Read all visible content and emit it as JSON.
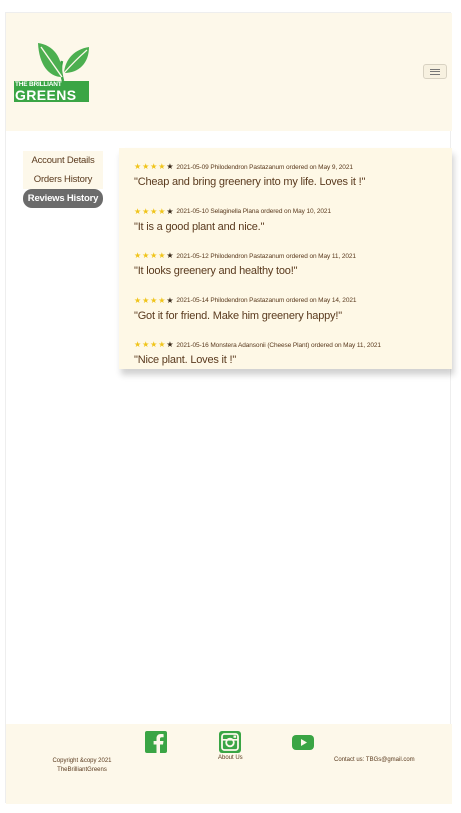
{
  "brand": {
    "line1": "THE BRILLIANT",
    "line2": "GREENS",
    "green": "#3aa545",
    "leaf_green": "#4caf50"
  },
  "header": {
    "menu_icon": "hamburger-menu-icon"
  },
  "sidebar": {
    "items": [
      {
        "label": "Account Details",
        "active": false
      },
      {
        "label": "Orders History",
        "active": false
      },
      {
        "label": "Reviews History",
        "active": true
      }
    ]
  },
  "reviews": [
    {
      "rating": 4,
      "date": "2021-05-09",
      "product": "Philodendron Pastazanum",
      "ordered": "ordered on May 9, 2021",
      "comment": "\"Cheap and bring greenery into my life. Loves it !\""
    },
    {
      "rating": 4,
      "date": "2021-05-10",
      "product": "Selaginella Plana",
      "ordered": "ordered on May 10, 2021",
      "comment": "\"It is a good plant and nice.\""
    },
    {
      "rating": 4,
      "date": "2021-05-12",
      "product": "Philodendron Pastazanum",
      "ordered": "ordered on May 11, 2021",
      "comment": "\"It looks greenery and healthy too!\""
    },
    {
      "rating": 4,
      "date": "2021-05-14",
      "product": "Philodendron Pastazanum",
      "ordered": "ordered on May 14, 2021",
      "comment": "\"Got it for friend. Make him greenery happy!\""
    },
    {
      "rating": 4,
      "date": "2021-05-16",
      "product": "Monstera Adansonii (Cheese Plant)",
      "ordered": "ordered on May 11, 2021",
      "comment": "\"Nice plant. Loves it !\""
    }
  ],
  "footer": {
    "copyright_line1": "Copyright &copy 2021",
    "copyright_line2": "TheBrilliantGreens",
    "about_label": "About Us",
    "contact": "Contact us: TBGs@gmail.com",
    "icons": [
      "facebook-icon",
      "instagram-icon",
      "youtube-icon"
    ],
    "icon_color": "#3aa545"
  },
  "colors": {
    "star_gold": "#f0c419",
    "star_empty": "#3a2a1a",
    "text_brown": "#5a3a1e",
    "cream": "#fdf8ea",
    "active_pill": "#6b6b6b"
  }
}
